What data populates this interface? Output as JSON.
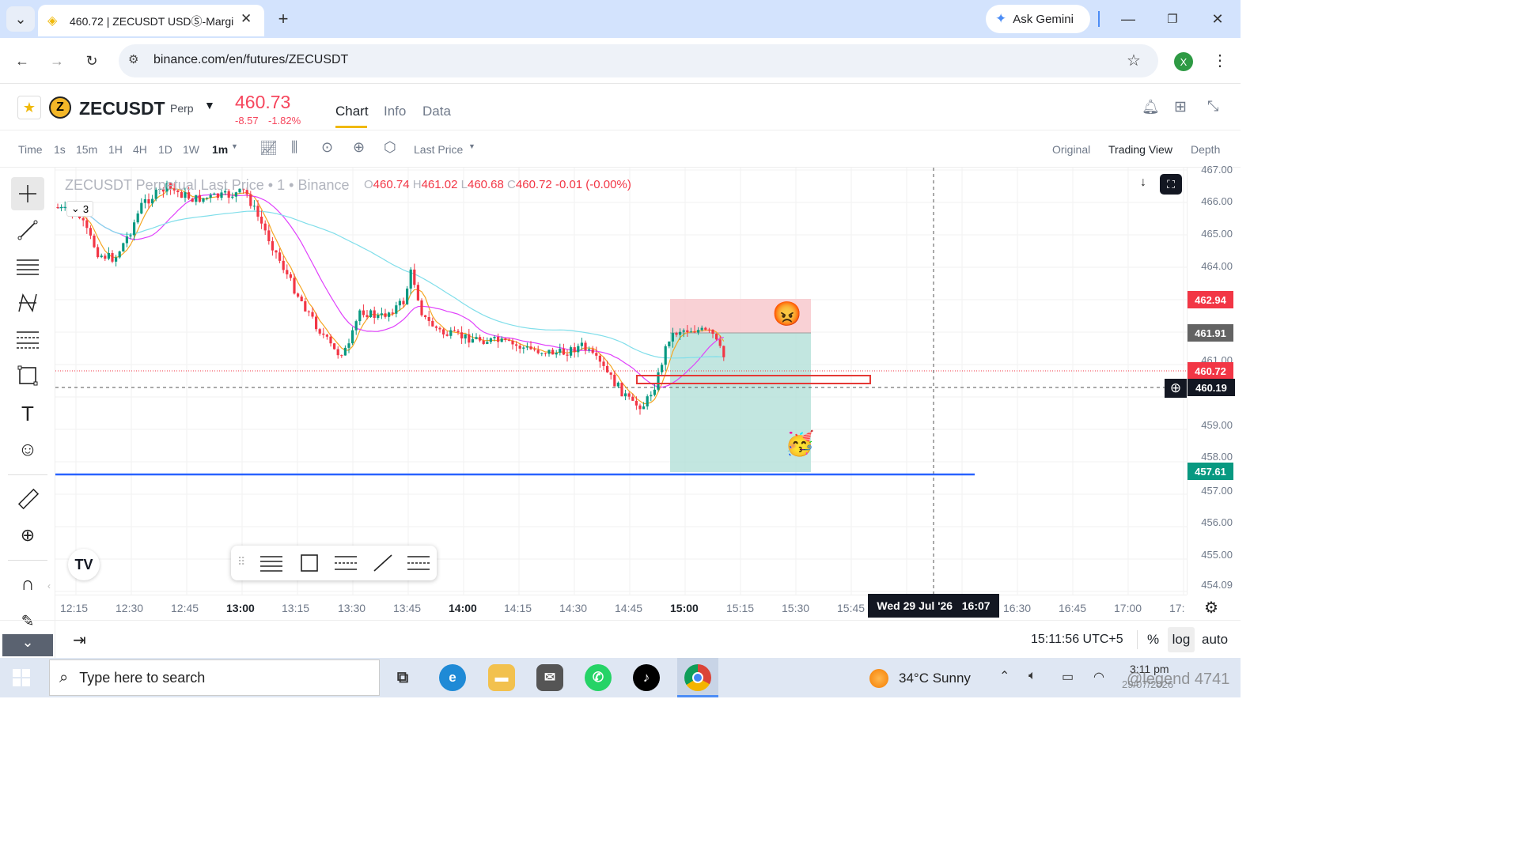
{
  "browser": {
    "tab_title": "460.72 | ZECUSDT USDⓈ-Margi",
    "url": "binance.com/en/futures/ZECUSDT",
    "ask_gemini": "Ask Gemini",
    "profile_initial": "X"
  },
  "header": {
    "symbol": "ZECUSDT",
    "contract_type": "Perp",
    "last_price": "460.73",
    "change": "-8.57",
    "change_pct": "-1.82%",
    "tabs": [
      "Chart",
      "Info",
      "Data"
    ],
    "active_tab": "Chart"
  },
  "chart_toolbar": {
    "intervals": [
      "Time",
      "1s",
      "15m",
      "1H",
      "4H",
      "1D",
      "1W",
      "1m"
    ],
    "active_interval": "1m",
    "price_type": "Last Price",
    "views": [
      "Original",
      "Trading View",
      "Depth"
    ],
    "active_view": "Trading View"
  },
  "legend": {
    "title": "ZECUSDT Perpetual Last Price",
    "interval": "1",
    "exchange": "Binance",
    "o_label": "O",
    "o": "460.74",
    "h_label": "H",
    "h": "461.02",
    "l_label": "L",
    "l": "460.68",
    "c_label": "C",
    "c": "460.72",
    "change": "-0.01 (-0.00%)",
    "indicator_count": "3"
  },
  "price_axis": {
    "labels": [
      "467.00",
      "466.00",
      "465.00",
      "464.00",
      "461.00",
      "459.00",
      "458.00",
      "457.00",
      "456.00",
      "455.00",
      "454.09"
    ],
    "badges": {
      "stop": "462.94",
      "entry": "461.91",
      "last": "460.72",
      "crosshair": "460.19",
      "target": "457.61"
    },
    "colors": {
      "stop": "#f23645",
      "entry": "#636363",
      "last": "#f23645",
      "crosshair": "#131722",
      "target": "#089981"
    }
  },
  "time_axis": {
    "labels": [
      "12:15",
      "12:30",
      "12:45",
      "13:00",
      "13:15",
      "13:30",
      "13:45",
      "14:00",
      "14:15",
      "14:30",
      "14:45",
      "15:00",
      "15:15",
      "15:30",
      "15:45",
      "16:30",
      "16:45",
      "17:00",
      "17:"
    ],
    "crosshair_label": "Wed 29 Jul '26   16:07"
  },
  "bottom_bar": {
    "clock": "15:11:56 UTC+5",
    "percent": "%",
    "log": "log",
    "auto": "auto"
  },
  "taskbar": {
    "search_placeholder": "Type here to search",
    "weather": "34°C  Sunny",
    "time": "3:11 pm",
    "date": "29/07/2026",
    "watermark": "@legend 4741"
  },
  "colors": {
    "up": "#089981",
    "down": "#f23645",
    "ma_fast": "#f5a623",
    "ma_mid": "#e040fb",
    "ma_slow": "#80deea",
    "support": "#2962ff",
    "accent": "#f0b90b"
  }
}
